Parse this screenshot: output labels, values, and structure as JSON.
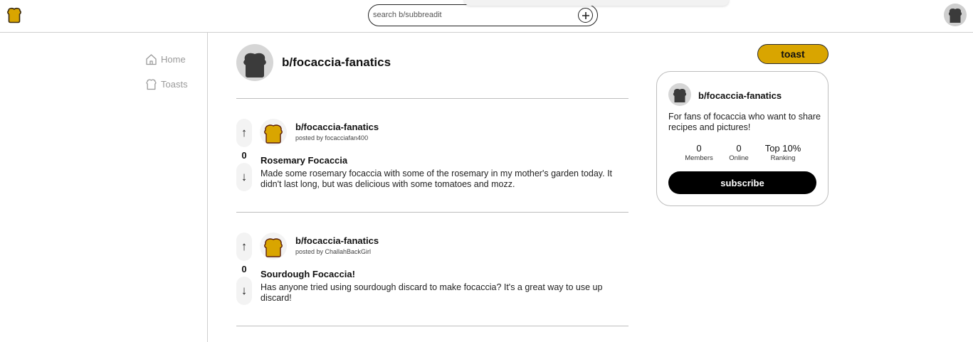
{
  "colors": {
    "accent": "#d9a500",
    "toast_dark": "#3b3b3b",
    "toast_gold": "#d9a500"
  },
  "header": {
    "logo_icon": "toast-logo-icon",
    "search": {
      "placeholder": "search b/subbreadit"
    },
    "add_icon": "plus-circle-icon",
    "avatar_icon": "toast-avatar-icon"
  },
  "sidebar": {
    "items": [
      {
        "label": "Home",
        "icon": "home-icon"
      },
      {
        "label": "Toasts",
        "icon": "toast-outline-icon"
      }
    ]
  },
  "subbreadit": {
    "name": "b/focaccia-fanatics"
  },
  "posts": [
    {
      "subbreadit": "b/focaccia-fanatics",
      "posted_by": "posted by focacciafan400",
      "title": "Rosemary Focaccia",
      "body": "Made some rosemary focaccia with some of the rosemary in my mother's garden today. It didn't last long, but was delicious with some tomatoes and mozz.",
      "votes": "0",
      "up_label": "↑",
      "down_label": "↓"
    },
    {
      "subbreadit": "b/focaccia-fanatics",
      "posted_by": "posted by ChallahBackGirl",
      "title": "Sourdough Focaccia!",
      "body": "Has anyone tried using sourdough discard to make focaccia? It's a great way to use up discard!",
      "votes": "0",
      "up_label": "↑",
      "down_label": "↓"
    }
  ],
  "right_panel": {
    "toast_button": "toast",
    "card": {
      "name": "b/focaccia-fanatics",
      "description": "For fans of focaccia who want to share recipes and pictures!",
      "stats": [
        {
          "value": "0",
          "label": "Members"
        },
        {
          "value": "0",
          "label": "Online"
        },
        {
          "value": "Top 10%",
          "label": "Ranking"
        }
      ],
      "subscribe_label": "subscribe"
    }
  }
}
